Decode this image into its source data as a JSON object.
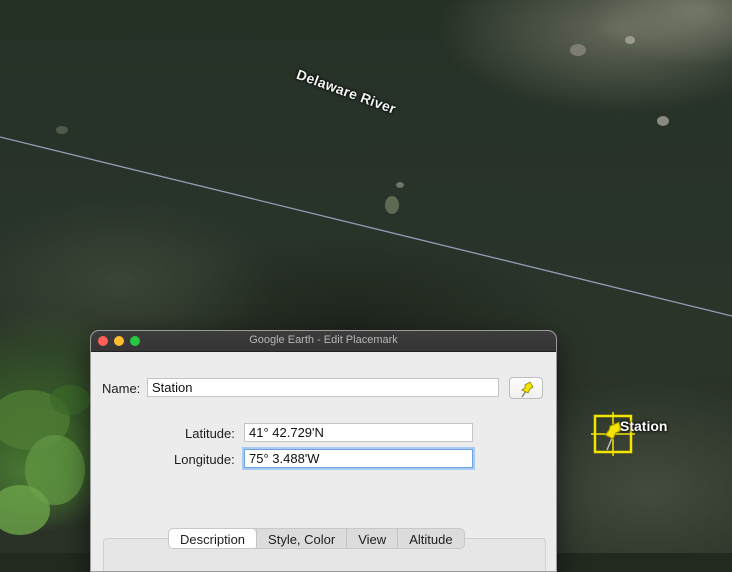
{
  "map": {
    "river_label": "Delaware River",
    "placemark_label": "Station",
    "placemark_icon": "yellow-pushpin-icon",
    "accent_yellow": "#f5e400"
  },
  "dialog": {
    "title": "Google Earth - Edit Placemark",
    "name_label": "Name:",
    "name_value": "Station",
    "pin_icon": "yellow-pushpin-icon",
    "latitude_label": "Latitude:",
    "latitude_value": "41° 42.729'N",
    "longitude_label": "Longitude:",
    "longitude_value": "75° 3.488'W",
    "tabs": [
      {
        "label": "Description",
        "active": true
      },
      {
        "label": "Style, Color",
        "active": false
      },
      {
        "label": "View",
        "active": false
      },
      {
        "label": "Altitude",
        "active": false
      }
    ]
  }
}
